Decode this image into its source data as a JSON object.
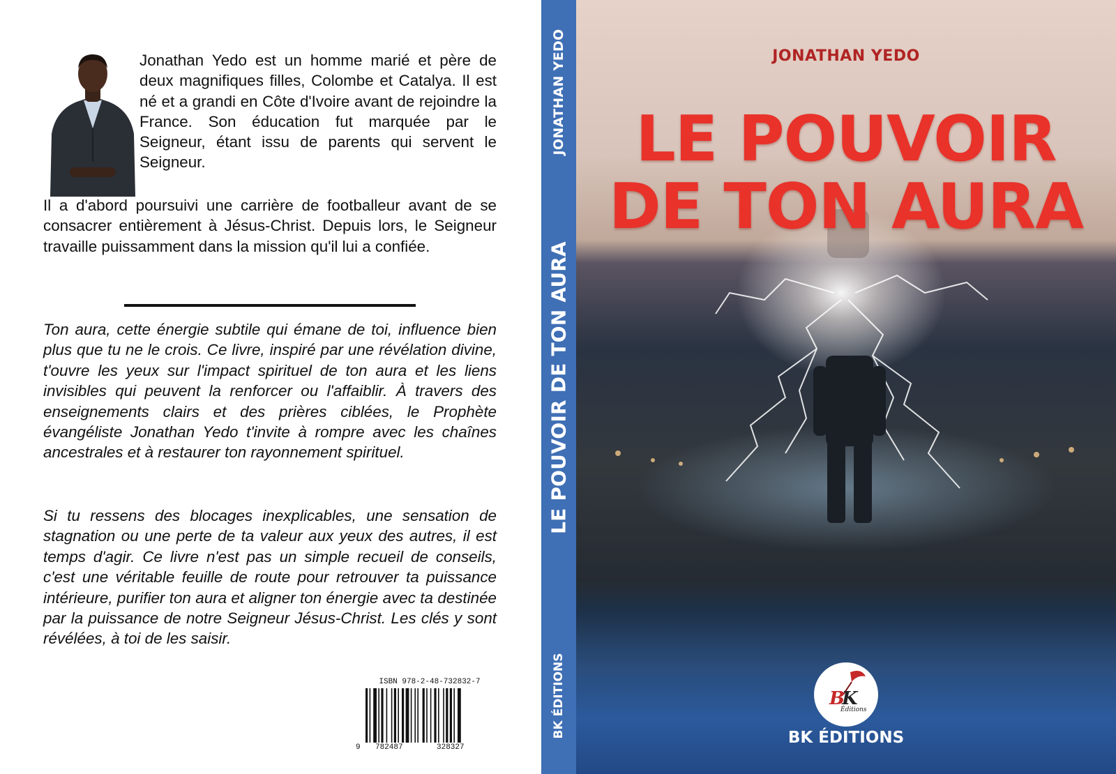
{
  "back_cover": {
    "bio_para1": "Jonathan Yedo est un homme marié et père de deux magnifiques filles, Colombe et Catalya. Il est né et a grandi en Côte d'Ivoire avant de rejoindre la France. Son éducation fut marquée par le Seigneur, étant issu de parents qui servent le Seigneur.",
    "bio_para2": "Il a d'abord poursuivi une carrière de footballeur avant de se consacrer entièrement à Jésus-Christ. Depuis lors, le Seigneur travaille puissamment dans la mission qu'il lui a confiée.",
    "blurb_para1": "Ton aura, cette énergie subtile qui émane de toi, influence bien plus que tu ne le crois. Ce livre, inspiré par une révélation divine, t'ouvre les yeux sur l'impact spirituel de ton aura et les liens invisibles qui peuvent la renforcer ou l'affaiblir. À travers des enseignements clairs et des prières ciblées, le Prophète évangéliste Jonathan Yedo t'invite à rompre avec les chaînes ancestrales et à restaurer ton rayonnement spirituel.",
    "blurb_para2": "Si tu ressens des blocages inexplicables, une sensation de stagnation ou une perte de ta valeur aux yeux des autres, il est temps d'agir. Ce livre n'est pas un simple recueil de conseils, c'est une véritable feuille de route pour retrouver ta puissance intérieure, purifier ton aura et aligner ton énergie avec ta destinée par la puissance de notre Seigneur Jésus-Christ. Les clés y sont révélées, à toi de les saisir.",
    "isbn": "ISBN 978-2-48-732832-7",
    "barcode_digit_lead": "9",
    "barcode_digits_left": "782487",
    "barcode_digits_right": "328327"
  },
  "spine": {
    "author": "JONATHAN YEDO",
    "title": "LE POUVOIR DE TON AURA",
    "publisher": "BK ÉDITIONS"
  },
  "front_cover": {
    "author": "JONATHAN YEDO",
    "title_line1": "LE POUVOIR",
    "title_line2": "DE TON AURA",
    "publisher": "BK ÉDITIONS",
    "logo_lettering": "BK Éditions"
  },
  "colors": {
    "spine_blue": "#3f6fb5",
    "title_red": "#e8322a",
    "author_red": "#b02424",
    "text_dark": "#111111"
  }
}
